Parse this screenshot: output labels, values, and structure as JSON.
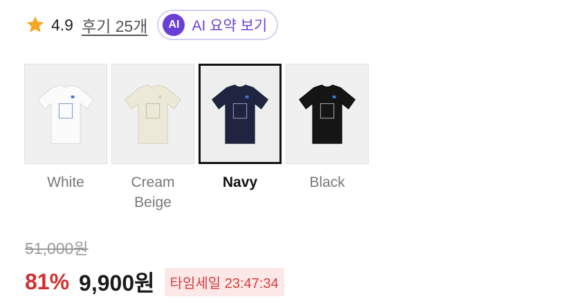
{
  "rating": {
    "value": "4.9",
    "reviews_label": "후기 25개",
    "star_icon": "star-icon",
    "star_color": "#f5a623"
  },
  "ai_summary": {
    "badge": "AI",
    "label": "AI 요약 보기",
    "accent": "#6b3fd6"
  },
  "colors": {
    "selected": "Navy",
    "options": [
      {
        "label": "White",
        "shirt_color": "#fbfbfb"
      },
      {
        "label": "Cream Beige",
        "shirt_color": "#ece9d8"
      },
      {
        "label": "Navy",
        "shirt_color": "#1f2440"
      },
      {
        "label": "Black",
        "shirt_color": "#151515"
      }
    ]
  },
  "price": {
    "original": "51,000원",
    "discount": "81%",
    "sale": "9,900원",
    "time_sale": "타임세일 23:47:34",
    "discount_color": "#d32f2f"
  }
}
